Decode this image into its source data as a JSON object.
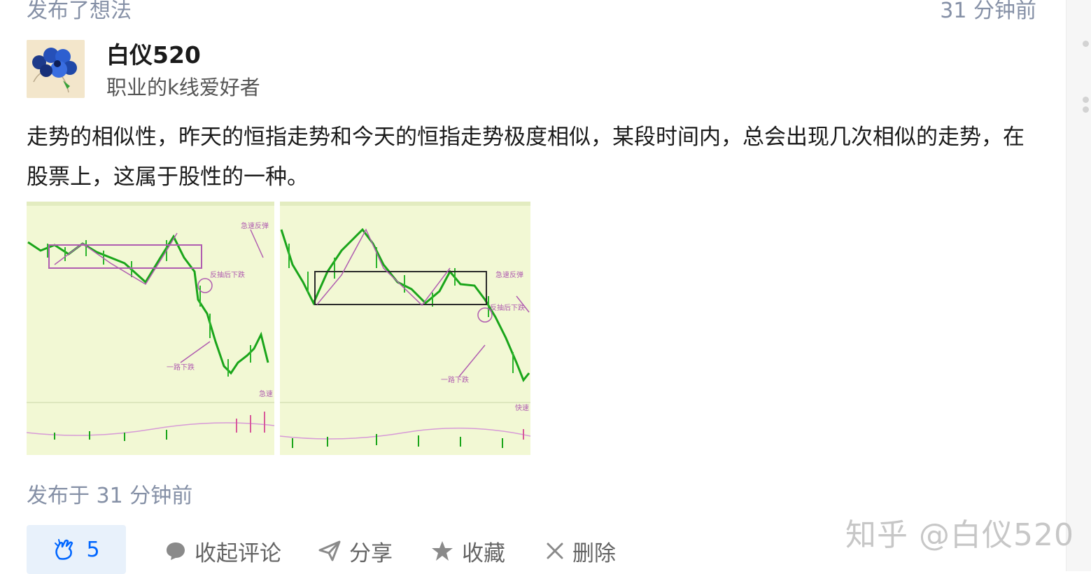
{
  "activity": {
    "action": "发布了想法",
    "time_top": "31 分钟前"
  },
  "author": {
    "name": "白仪520",
    "bio": "职业的k线爱好者",
    "avatar_icon": "flower-avatar"
  },
  "post": {
    "text": "走势的相似性，昨天的恒指走势和今天的恒指走势极度相似，某段时间内，总会出现几次相似的走势，在股票上，这属于股性的一种。",
    "published": "发布于 31 分钟前",
    "image": {
      "panel_left": {
        "annotations": [
          "急速反弹",
          "反抽后下跌",
          "一路下跌",
          "急速"
        ]
      },
      "panel_right": {
        "annotations": [
          "急速反弹",
          "反抽后下跌",
          "一路下跌",
          "快速"
        ]
      }
    }
  },
  "actions": {
    "like_count": "5",
    "comment": "收起评论",
    "share": "分享",
    "favorite": "收藏",
    "delete": "删除"
  },
  "watermark": "知乎 @白仪520",
  "colors": {
    "accent": "#0066ff",
    "muted": "#8590a6",
    "chart_bg": "#f2f8d4",
    "candle_green": "#1aa51a",
    "annotation": "#b05db0"
  }
}
